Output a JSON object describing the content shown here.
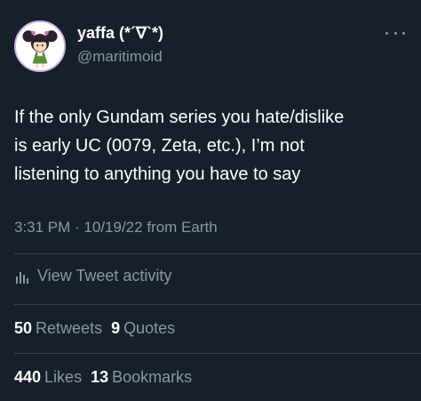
{
  "author": {
    "display_name": "yaffa (*´∇`*)",
    "handle": "@maritimoid",
    "avatar_icon": "anime-girl-avatar-icon"
  },
  "menu_icon": "more-options-icon",
  "tweet": {
    "lines": [
      "If the only Gundam series you hate/dislike",
      "is early UC (0079, Zeta, etc.), I’m not",
      "listening to anything you have to say"
    ],
    "meta": "3:31 PM · 10/19/22 from Earth"
  },
  "activity": {
    "label": "View Tweet activity",
    "icon": "bar-chart-icon"
  },
  "stats": {
    "retweets_count": "50",
    "retweets_label": "Retweets",
    "quotes_count": "9",
    "quotes_label": "Quotes",
    "likes_count": "440",
    "likes_label": "Likes",
    "bookmarks_count": "13",
    "bookmarks_label": "Bookmarks"
  },
  "colors": {
    "background": "#15202b",
    "secondary_text": "#8b98a5",
    "divider": "#38444d"
  }
}
